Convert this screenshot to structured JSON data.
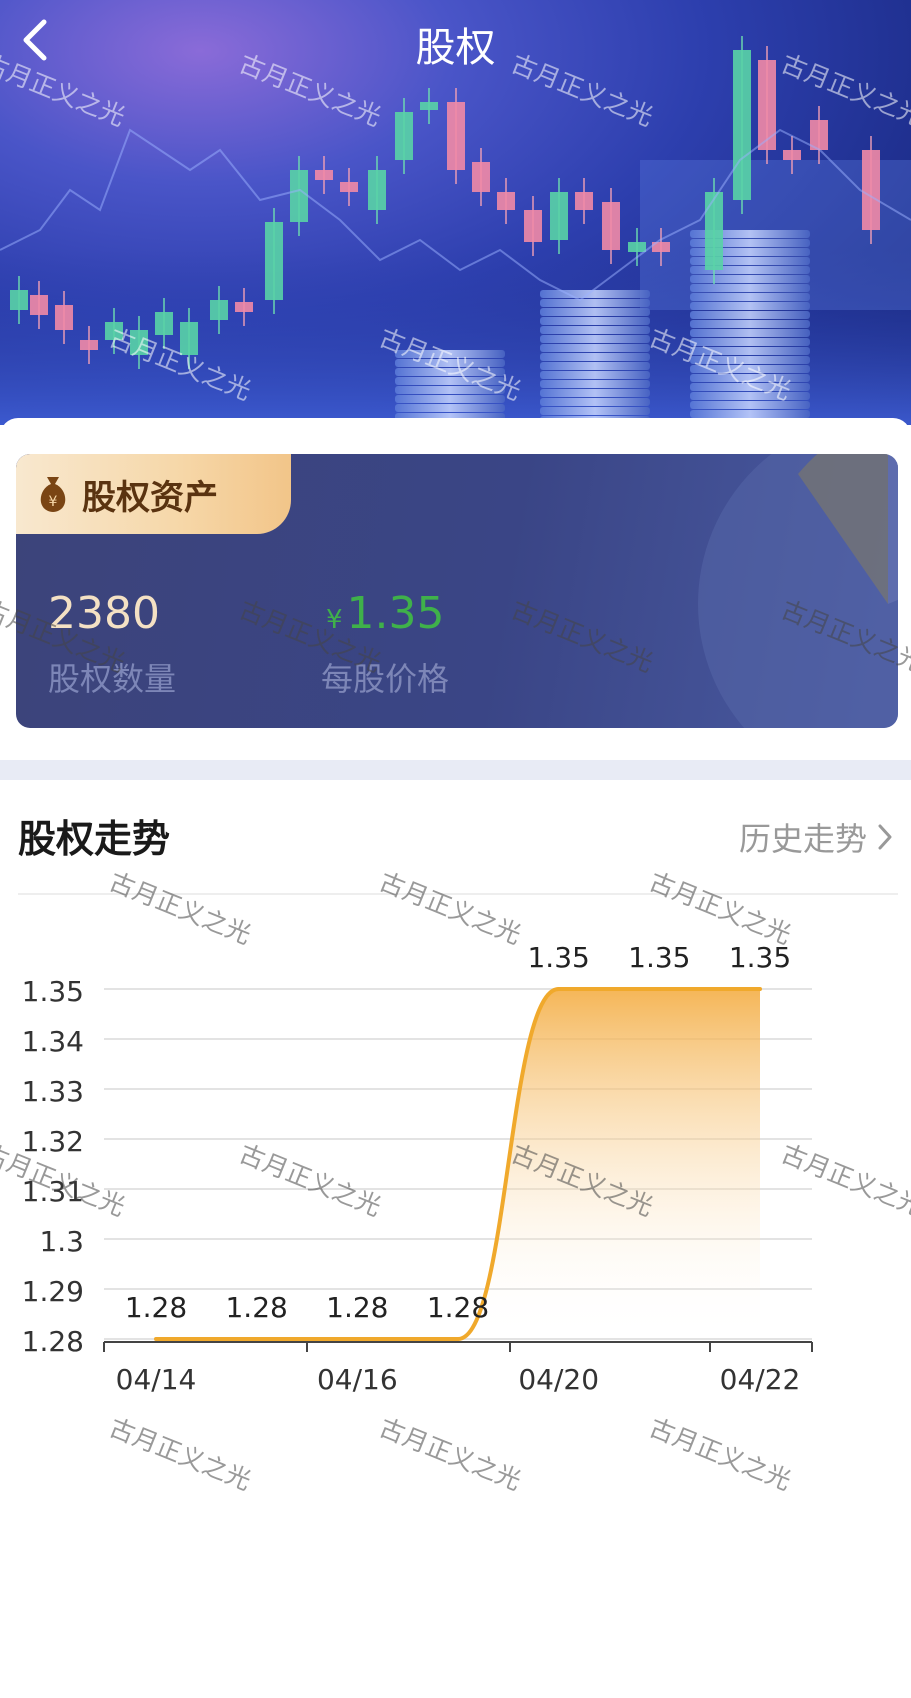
{
  "header": {
    "title": "股权",
    "back_icon": "chevron-left-icon"
  },
  "assets": {
    "tab_label": "股权资产",
    "tab_icon": "money-bag-icon",
    "quantity_value": "2380",
    "quantity_label": "股权数量",
    "price_currency": "¥",
    "price_value": "1.35",
    "price_label": "每股价格"
  },
  "trend": {
    "title": "股权走势",
    "history_link": "历史走势",
    "history_icon": "chevron-right-icon"
  },
  "watermark": {
    "text": "古月正义之光"
  },
  "colors": {
    "line": "#f0a92c",
    "price_green": "#3fb14a",
    "card_bg": "#3a4586",
    "tab_bg": "#f6d7a8"
  },
  "chart_data": {
    "type": "line",
    "smooth": true,
    "area_fill": true,
    "x": [
      "04/14",
      "04/15",
      "04/16",
      "04/17",
      "04/20",
      "04/21",
      "04/22"
    ],
    "values": [
      1.28,
      1.28,
      1.28,
      1.28,
      1.35,
      1.35,
      1.35
    ],
    "data_labels": [
      "1.28",
      "1.28",
      "1.28",
      "1.28",
      "1.35",
      "1.35",
      "1.35"
    ],
    "y_ticks": [
      "1.28",
      "1.29",
      "1.3",
      "1.31",
      "1.32",
      "1.33",
      "1.34",
      "1.35"
    ],
    "x_tick_labels": [
      "04/14",
      "04/16",
      "04/20",
      "04/22"
    ],
    "ylim": [
      1.28,
      1.35
    ],
    "grid": true,
    "title": "",
    "xlabel": "",
    "ylabel": ""
  }
}
